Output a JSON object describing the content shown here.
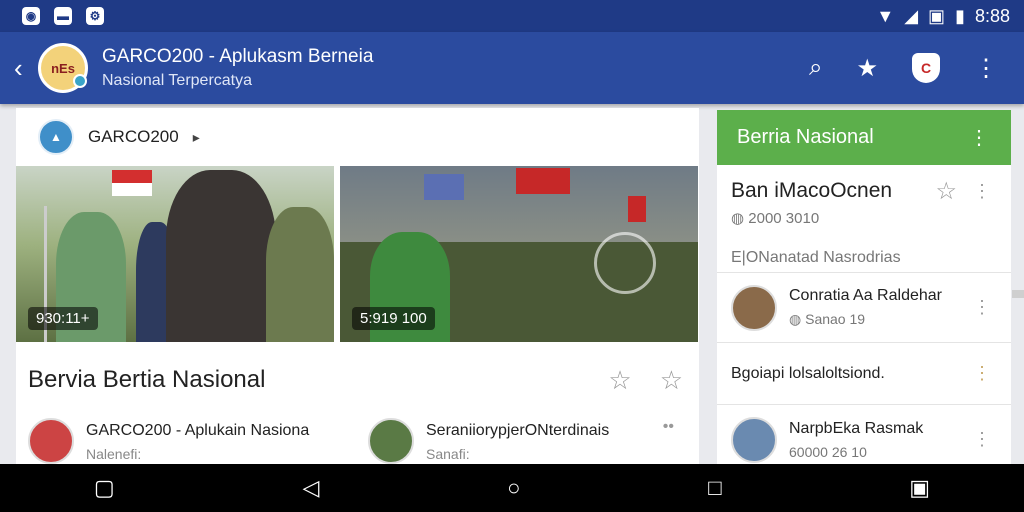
{
  "statusbar": {
    "time": "8:88"
  },
  "appbar": {
    "title": "GARCO200 - Aplukasm Berneia",
    "subtitle": "Nasional Terpercatya",
    "logo_text": "nEs"
  },
  "main": {
    "source_name": "GARCO200",
    "images": [
      {
        "overlay": "930:11+"
      },
      {
        "overlay": "5:919 100"
      }
    ],
    "headline": "Bervia  Bertia Nasional",
    "posts": [
      {
        "title": "GARCO200 - Aplukain Nasiona",
        "sub": "Nalenefi:"
      },
      {
        "title": "SeraniiorypjerONterdinais",
        "sub": "Sanafi:"
      }
    ]
  },
  "sidebar": {
    "header": "Berria Nasional",
    "featured": {
      "title": "Ban iMacoOcnen",
      "date": "2000 3010",
      "desc": "E|ONanatad Nasrodrias"
    },
    "items": [
      {
        "title": "Conratia Aa Raldehar",
        "sub": "Sanao 19"
      },
      {
        "title": "Bgoiapi lolsaloltsiond."
      },
      {
        "title": "NarpbEka Rasmak",
        "sub": "60000 26 10"
      }
    ]
  },
  "colors": {
    "appbar": "#2b4b9f",
    "sidebar_header": "#5caf4b"
  }
}
